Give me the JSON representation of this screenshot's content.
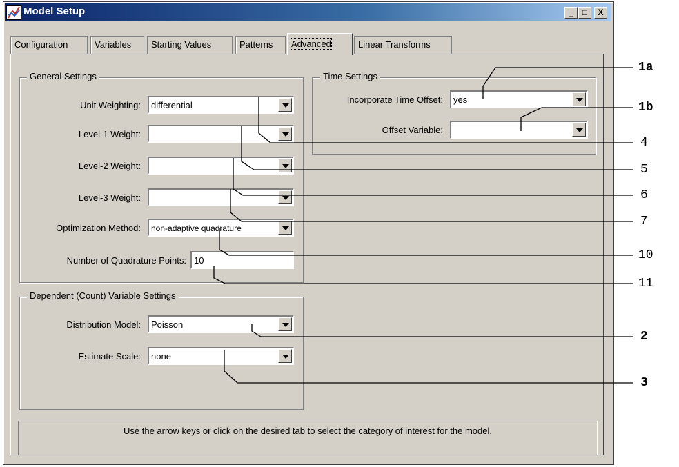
{
  "window": {
    "title": "Model Setup"
  },
  "title_buttons": {
    "minimize": "_",
    "maximize": "□",
    "close": "X"
  },
  "tabs": [
    {
      "label": "Configuration",
      "active": false
    },
    {
      "label": "Variables",
      "active": false
    },
    {
      "label": "Starting Values",
      "active": false
    },
    {
      "label": "Patterns",
      "active": false
    },
    {
      "label": "Advanced",
      "active": true
    },
    {
      "label": "Linear Transforms",
      "active": false
    }
  ],
  "general": {
    "legend": "General Settings",
    "unit_weighting": {
      "label": "Unit Weighting:",
      "value": "differential"
    },
    "level1": {
      "label": "Level-1 Weight:",
      "value": ""
    },
    "level2": {
      "label": "Level-2 Weight:",
      "value": ""
    },
    "level3": {
      "label": "Level-3 Weight:",
      "value": ""
    },
    "optimization": {
      "label": "Optimization Method:",
      "value": "non-adaptive quadrature"
    },
    "quadrature": {
      "label": "Number of Quadrature Points:",
      "value": "10"
    }
  },
  "dependent": {
    "legend": "Dependent (Count) Variable Settings",
    "distribution": {
      "label": "Distribution Model:",
      "value": "Poisson"
    },
    "scale": {
      "label": "Estimate Scale:",
      "value": "none"
    }
  },
  "time": {
    "legend": "Time Settings",
    "offset": {
      "label": "Incorporate Time Offset:",
      "value": "yes"
    },
    "offset_variable": {
      "label": "Offset Variable:",
      "value": ""
    }
  },
  "status_text": "Use the arrow keys or click on the desired tab to select the category of interest for the model.",
  "callouts": [
    "1a",
    "1b",
    "4",
    "5",
    "6",
    "7",
    "10",
    "11",
    "2",
    "3"
  ]
}
